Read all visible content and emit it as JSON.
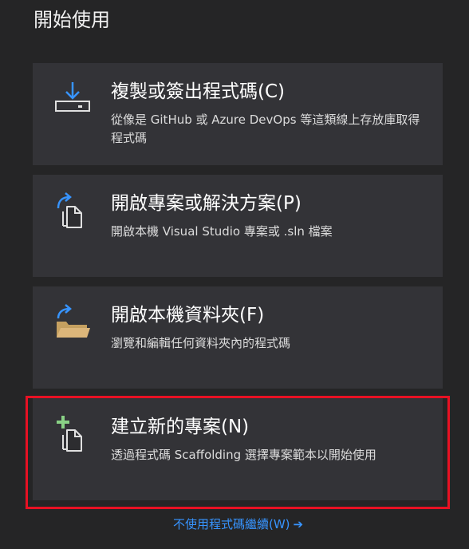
{
  "page": {
    "title": "開始使用"
  },
  "cards": [
    {
      "title": "複製或簽出程式碼(C)",
      "description": "從像是 GitHub 或 Azure DevOps 等這類線上存放庫取得程式碼",
      "icon": "download-icon"
    },
    {
      "title": "開啟專案或解決方案(P)",
      "description": "開啟本機 Visual Studio 專案或 .sln 檔案",
      "icon": "open-project-icon"
    },
    {
      "title": "開啟本機資料夾(F)",
      "description": "瀏覽和編輯任何資料夾內的程式碼",
      "icon": "open-folder-icon"
    },
    {
      "title": "建立新的專案(N)",
      "description": "透過程式碼 Scaffolding 選擇專案範本以開始使用",
      "icon": "new-project-icon"
    }
  ],
  "footer": {
    "continue_label": "不使用程式碼繼續(W)",
    "arrow": "➔"
  },
  "colors": {
    "background": "#252526",
    "card": "#333337",
    "highlight": "#e81123",
    "link": "#3794ff",
    "icon_blue": "#3794ff",
    "icon_green": "#89d185",
    "folder": "#dcb67a"
  }
}
